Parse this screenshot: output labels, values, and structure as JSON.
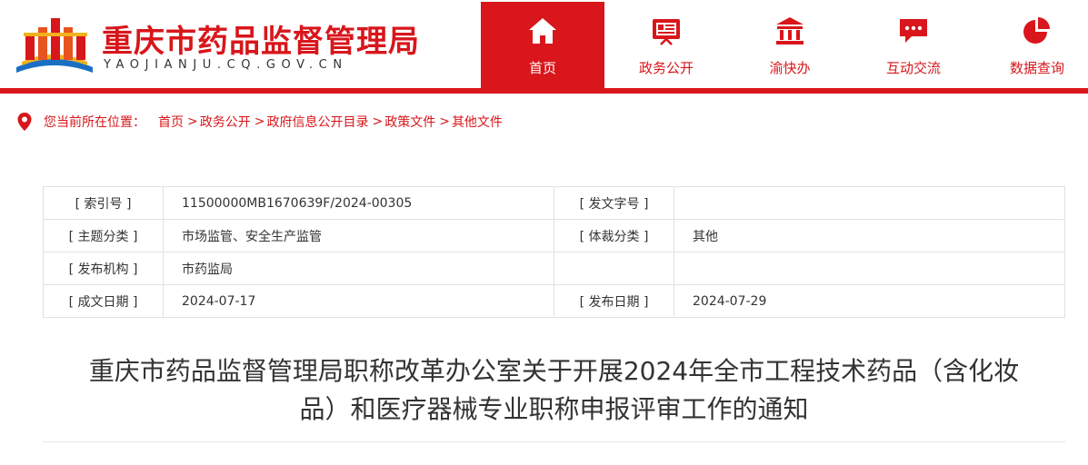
{
  "header": {
    "site_title": "重庆市药品监督管理局",
    "site_domain": "YAOJIANJU.CQ.GOV.CN",
    "brand_color": "#d8161b"
  },
  "nav": [
    {
      "label": "首页",
      "icon": "home-icon",
      "active": true
    },
    {
      "label": "政务公开",
      "icon": "presentation-board-icon",
      "active": false
    },
    {
      "label": "渝快办",
      "icon": "government-building-icon",
      "active": false
    },
    {
      "label": "互动交流",
      "icon": "chat-bubble-icon",
      "active": false
    },
    {
      "label": "数据查询",
      "icon": "pie-chart-icon",
      "active": false
    }
  ],
  "breadcrumb": {
    "prefix": "您当前所在位置：",
    "items": [
      "首页",
      "政务公开",
      "政府信息公开目录",
      "政策文件",
      "其他文件"
    ],
    "separator": ">"
  },
  "info": {
    "index_label": "[ 索引号 ]",
    "index_value": "11500000MB1670639F/2024-00305",
    "doc_no_label": "[ 发文字号 ]",
    "doc_no_value": "",
    "topic_label": "[ 主题分类 ]",
    "topic_value": "市场监管、安全生产监管",
    "genre_label": "[ 体裁分类 ]",
    "genre_value": "其他",
    "issuer_label": "[ 发布机构 ]",
    "issuer_value": "市药监局",
    "created_label": "[ 成文日期 ]",
    "created_value": "2024-07-17",
    "published_label": "[ 发布日期 ]",
    "published_value": "2024-07-29"
  },
  "document": {
    "title_line1": "重庆市药品监督管理局职称改革办公室关于开展2024年全市工程技术药品（含化妆",
    "title_line2": "品）和医疗器械专业职称申报评审工作的通知"
  }
}
